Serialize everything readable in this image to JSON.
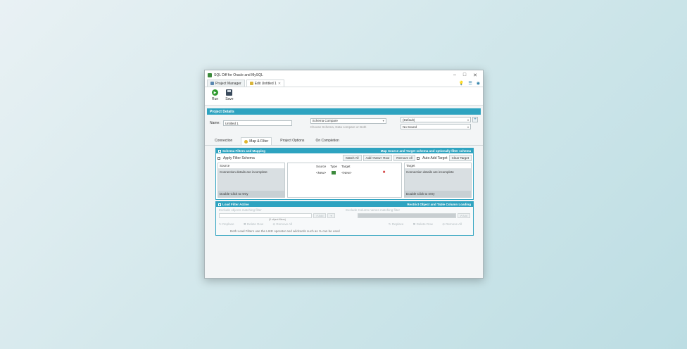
{
  "window": {
    "title": "SQL Diff for Oracle and MySQL",
    "controls": [
      "–",
      "□",
      "✕"
    ]
  },
  "tabs": [
    {
      "label": "Project Manager"
    },
    {
      "label": "Edit Untitled 1"
    }
  ],
  "toolbar": {
    "run_label": "Run",
    "save_label": "Save"
  },
  "project_details": {
    "header": "Project Details",
    "name_label": "Name:",
    "name_value": "Untitled 1",
    "schema_compare": "Schema Compare",
    "schema_hint": "Choose Schema, Data compare or Both",
    "default_option": "(Default)",
    "sound_option": "No Sound"
  },
  "feature_tabs": [
    "Connection",
    "Map & Filter",
    "Project Options",
    "On Completion"
  ],
  "schema_filters": {
    "header": "Schema Filters and Mapping",
    "header_right": "Map Source and Target schema and optionally filter schema",
    "apply_filter": "Apply Filter Schema",
    "match_all": "Match All",
    "add_new_row": "Add <New> Row",
    "remove_all": "Remove All",
    "auto_add_target": "Auto Add Target",
    "clear_target": "Clear Target",
    "source_label": "Source",
    "source_body": "Connection details are incomplete",
    "source_foot": "Double Click to retry",
    "map_source": "Source",
    "map_type": "Type",
    "map_target": "Target",
    "row_source": "<New>",
    "row_target": "<New>",
    "target_label": "Target",
    "target_body": "Connection details are incomplete",
    "target_foot": "Double Click to retry"
  },
  "load_filter": {
    "header": "Load Filter Active",
    "header_right": "Restrict Object and Table Column Loading",
    "exclude_objects": "Exclude objects matching filter",
    "exclude_columns": "Exclude Column names matching filter",
    "add_label": "Add",
    "count_label": "(0 object filters)",
    "btn_replace": "Replace",
    "btn_delete_row": "Delete Row",
    "btn_remove_all": "Remove All",
    "note": "Both Load Filters use the LIKE operator and wildcards such as % can be used"
  }
}
